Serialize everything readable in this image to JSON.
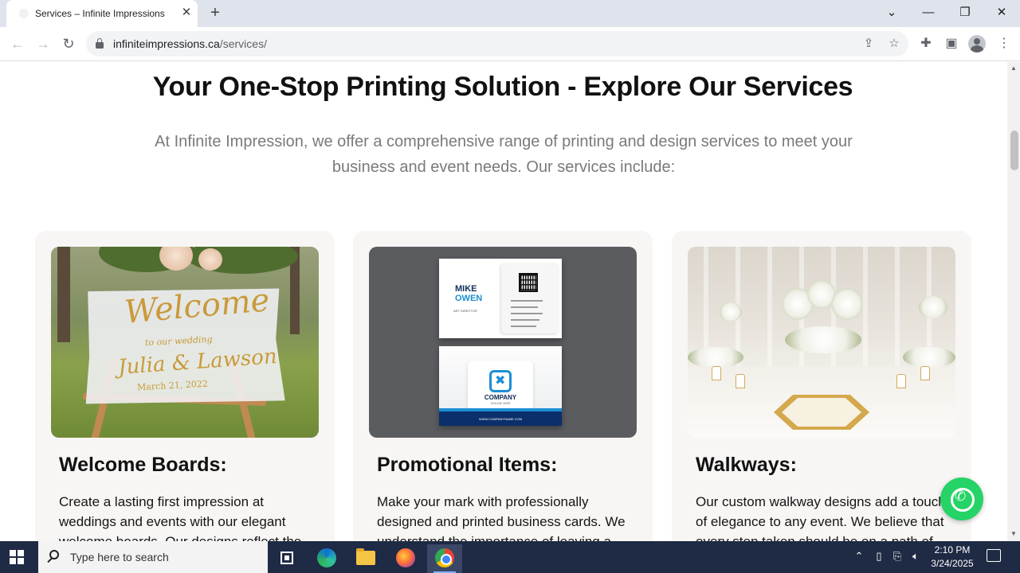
{
  "browser": {
    "tab_title": "Services – Infinite Impressions",
    "url_domain": "infiniteimpressions.ca",
    "url_path": "/services/",
    "new_tab_symbol": "+",
    "close_symbol": "✕"
  },
  "page": {
    "title": "Your One-Stop Printing Solution - Explore Our Services",
    "intro": "At Infinite Impression, we offer a comprehensive range of printing and design services to meet your business and event needs. Our services include:",
    "cards": [
      {
        "title": "Welcome Boards:",
        "text": "Create a lasting first impression at weddings and events with our elegant welcome boards. Our designs reflect the",
        "image": {
          "line1": "Welcome",
          "line2": "to our wedding",
          "line3": "Julia & Lawson",
          "line4": "March 21, 2022"
        }
      },
      {
        "title": "Promotional Items:",
        "text": "Make your mark with professionally designed and printed business cards. We understand the importance of leaving a",
        "image": {
          "name_first": "MIKE",
          "name_last": "OWEN",
          "role": "ART DIRECTOR",
          "company": "COMPANY",
          "tagline": "TAGLINE HERE",
          "website": "WWW.COMPANYNAME.COM"
        }
      },
      {
        "title": "Walkways:",
        "text": "Our custom walkway designs add a touch of elegance to any event. We believe that every step taken should be on a path of",
        "image": {}
      }
    ]
  },
  "taskbar": {
    "search_placeholder": "Type here to search",
    "time": "2:10 PM",
    "date": "3/24/2025"
  },
  "colors": {
    "whatsapp": "#25d366",
    "taskbar": "#1f2a44",
    "card_bg": "#f8f6f4"
  },
  "icons": [
    "lock-icon",
    "share-icon",
    "star-icon",
    "extensions-icon",
    "side-panel-icon",
    "profile-icon",
    "menu-icon",
    "whatsapp-icon",
    "windows-start-icon",
    "search-icon",
    "task-view-icon",
    "edge-icon",
    "file-explorer-icon",
    "firefox-icon",
    "chrome-icon",
    "network-icon",
    "volume-icon",
    "notification-icon"
  ]
}
